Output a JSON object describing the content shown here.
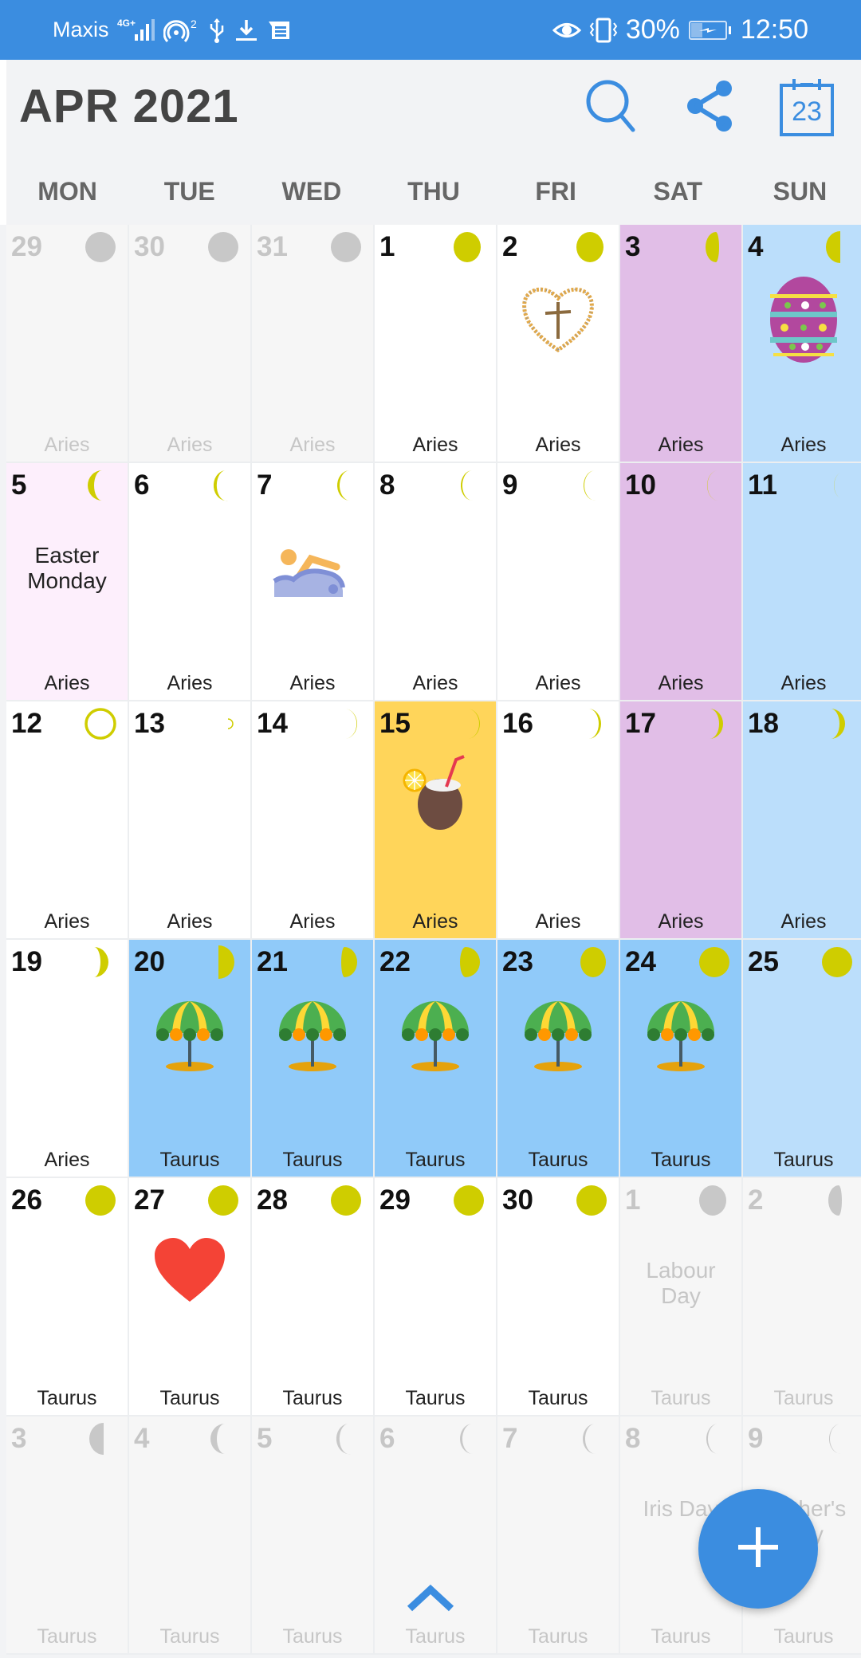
{
  "status_bar": {
    "carrier": "Maxis",
    "network": "4G+",
    "hotspot_count": "2",
    "battery": "30%",
    "time": "12:50",
    "icons": [
      "signal-icon",
      "hotspot-icon",
      "usb-icon",
      "download-icon",
      "message-icon",
      "eye-comfort-icon",
      "vibrate-icon",
      "battery-charging-icon"
    ]
  },
  "header": {
    "title": "APR 2021",
    "today_badge": "23",
    "actions": [
      "search-icon",
      "share-icon",
      "today-calendar-icon"
    ]
  },
  "weekdays": [
    "MON",
    "TUE",
    "WED",
    "THU",
    "FRI",
    "SAT",
    "SUN"
  ],
  "colors": {
    "accent": "#3b8de0",
    "moon": "#cfcd00",
    "moon_other": "#c8c8c8",
    "saturday": "#e1bee7",
    "sunday": "#bbdefb",
    "holiday_light": "#fdeffc",
    "highlight_yellow": "#ffd55a",
    "vacation_blue": "#90caf9"
  },
  "cells": [
    {
      "day": "29",
      "zodiac": "Aries",
      "other": true,
      "moon": "full"
    },
    {
      "day": "30",
      "zodiac": "Aries",
      "other": true,
      "moon": "full"
    },
    {
      "day": "31",
      "zodiac": "Aries",
      "other": true,
      "moon": "full"
    },
    {
      "day": "1",
      "zodiac": "Aries",
      "moon": "waning-gibbous"
    },
    {
      "day": "2",
      "zodiac": "Aries",
      "moon": "waning-gibbous",
      "sticker": "heart-cross-icon"
    },
    {
      "day": "3",
      "zodiac": "Aries",
      "moon": "waning-gibbous2",
      "bg": "saturday"
    },
    {
      "day": "4",
      "zodiac": "Aries",
      "moon": "last-quarter",
      "bg": "sunday",
      "sticker": "easter-egg-icon"
    },
    {
      "day": "5",
      "zodiac": "Aries",
      "moon": "waning-crescent1",
      "bg": "holiday_light",
      "event": "Easter Monday"
    },
    {
      "day": "6",
      "zodiac": "Aries",
      "moon": "waning-crescent2"
    },
    {
      "day": "7",
      "zodiac": "Aries",
      "moon": "waning-crescent3",
      "sticker": "swimming-icon"
    },
    {
      "day": "8",
      "zodiac": "Aries",
      "moon": "waning-crescent4"
    },
    {
      "day": "9",
      "zodiac": "Aries",
      "moon": "waning-crescent5"
    },
    {
      "day": "10",
      "zodiac": "Aries",
      "moon": "waning-crescent6",
      "bg": "saturday"
    },
    {
      "day": "11",
      "zodiac": "Aries",
      "moon": "waning-crescent7",
      "bg": "sunday"
    },
    {
      "day": "12",
      "zodiac": "Aries",
      "moon": "new"
    },
    {
      "day": "13",
      "zodiac": "Aries",
      "moon": "waxing-crescent1"
    },
    {
      "day": "14",
      "zodiac": "Aries",
      "moon": "waxing-crescent2"
    },
    {
      "day": "15",
      "zodiac": "Aries",
      "moon": "waxing-crescent3",
      "bg": "highlight_yellow",
      "sticker": "coconut-drink-icon"
    },
    {
      "day": "16",
      "zodiac": "Aries",
      "moon": "waxing-crescent4"
    },
    {
      "day": "17",
      "zodiac": "Aries",
      "moon": "waxing-crescent5",
      "bg": "saturday"
    },
    {
      "day": "18",
      "zodiac": "Aries",
      "moon": "waxing-crescent6",
      "bg": "sunday"
    },
    {
      "day": "19",
      "zodiac": "Aries",
      "moon": "waxing-crescent7"
    },
    {
      "day": "20",
      "zodiac": "Taurus",
      "moon": "first-quarter",
      "bg": "vacation_blue",
      "sticker": "beach-umbrella-icon"
    },
    {
      "day": "21",
      "zodiac": "Taurus",
      "moon": "waxing-gibbous1",
      "bg": "vacation_blue",
      "sticker": "beach-umbrella-icon"
    },
    {
      "day": "22",
      "zodiac": "Taurus",
      "moon": "waxing-gibbous2",
      "bg": "vacation_blue",
      "sticker": "beach-umbrella-icon"
    },
    {
      "day": "23",
      "zodiac": "Taurus",
      "moon": "waxing-gibbous3",
      "bg": "vacation_blue",
      "sticker": "beach-umbrella-icon"
    },
    {
      "day": "24",
      "zodiac": "Taurus",
      "moon": "full",
      "bg": "vacation_blue",
      "sticker": "beach-umbrella-icon"
    },
    {
      "day": "25",
      "zodiac": "Taurus",
      "moon": "full",
      "bg": "sunday"
    },
    {
      "day": "26",
      "zodiac": "Taurus",
      "moon": "full"
    },
    {
      "day": "27",
      "zodiac": "Taurus",
      "moon": "full",
      "sticker": "red-heart-icon"
    },
    {
      "day": "28",
      "zodiac": "Taurus",
      "moon": "full"
    },
    {
      "day": "29",
      "zodiac": "Taurus",
      "moon": "full"
    },
    {
      "day": "30",
      "zodiac": "Taurus",
      "moon": "full"
    },
    {
      "day": "1",
      "zodiac": "Taurus",
      "other": true,
      "moon": "waning-gibbous",
      "event": "Labour Day"
    },
    {
      "day": "2",
      "zodiac": "Taurus",
      "other": true,
      "moon": "waning-gibbous2"
    },
    {
      "day": "3",
      "zodiac": "Taurus",
      "other": true,
      "moon": "last-quarter"
    },
    {
      "day": "4",
      "zodiac": "Taurus",
      "other": true,
      "moon": "waning-crescent1"
    },
    {
      "day": "5",
      "zodiac": "Taurus",
      "other": true,
      "moon": "waning-crescent2"
    },
    {
      "day": "6",
      "zodiac": "Taurus",
      "other": true,
      "moon": "waning-crescent3"
    },
    {
      "day": "7",
      "zodiac": "Taurus",
      "other": true,
      "moon": "waning-crescent3"
    },
    {
      "day": "8",
      "zodiac": "Taurus",
      "other": true,
      "moon": "waning-crescent4",
      "event": "Iris Day"
    },
    {
      "day": "9",
      "zodiac": "Taurus",
      "other": true,
      "moon": "waning-crescent5",
      "event": "Mother's Day"
    }
  ],
  "fab": {
    "icon": "plus-icon",
    "label": "Add event"
  },
  "scroll_up": {
    "icon": "chevron-up-icon"
  }
}
